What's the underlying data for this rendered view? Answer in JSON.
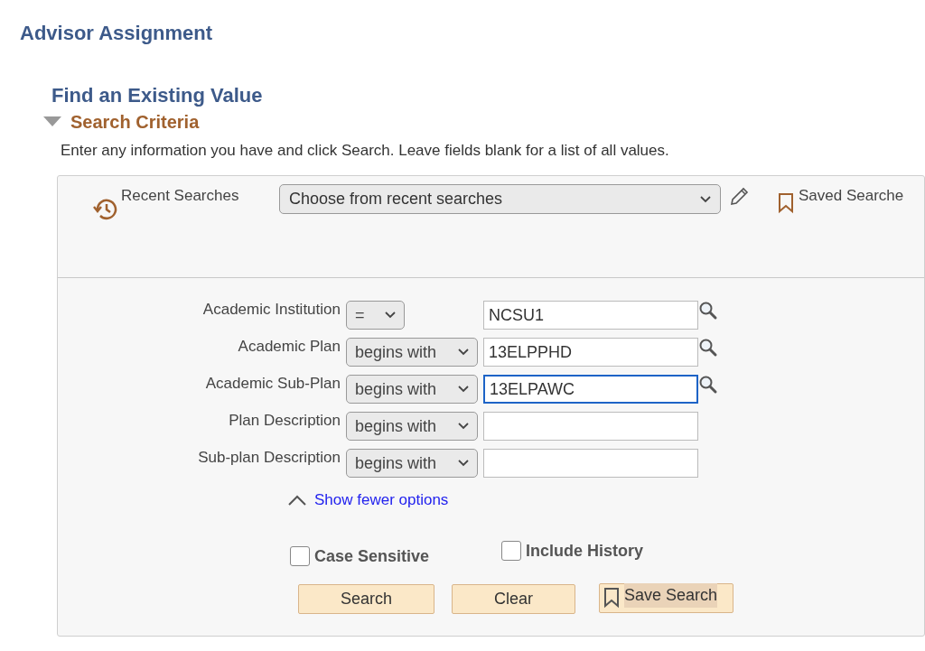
{
  "page_title": "Advisor Assignment",
  "section_title": "Find an Existing Value",
  "search_criteria": {
    "label": "Search Criteria",
    "expanded": true
  },
  "instructions": "Enter any information you have and click Search. Leave fields blank for a list of all values.",
  "recent_searches": {
    "label": "Recent Searches",
    "value": "Choose from recent searches"
  },
  "saved_searches": {
    "label": "Saved Searche"
  },
  "fields": [
    {
      "label": "Academic Institution",
      "operator": "=",
      "value": "NCSU1",
      "focused": false,
      "lookup": true
    },
    {
      "label": "Academic Plan",
      "operator": "begins with",
      "value": "13ELPPHD",
      "focused": false,
      "lookup": true
    },
    {
      "label": "Academic Sub-Plan",
      "operator": "begins with",
      "value": "13ELPAWC",
      "focused": true,
      "lookup": true
    },
    {
      "label": "Plan Description",
      "operator": "begins with",
      "focused": false,
      "lookup": false
    },
    {
      "label": "Sub-plan Description",
      "operator": "begins with",
      "focused": false,
      "lookup": false
    }
  ],
  "options_link": "Show fewer options",
  "checkboxes": [
    {
      "label": "Case Sensitive",
      "checked": false
    },
    {
      "label": "Include History",
      "checked": false
    }
  ],
  "buttons": [
    {
      "label": "Search",
      "kind": "plain"
    },
    {
      "label": "Clear",
      "kind": "plain"
    },
    {
      "label": "Save Search",
      "kind": "bookmark"
    }
  ]
}
